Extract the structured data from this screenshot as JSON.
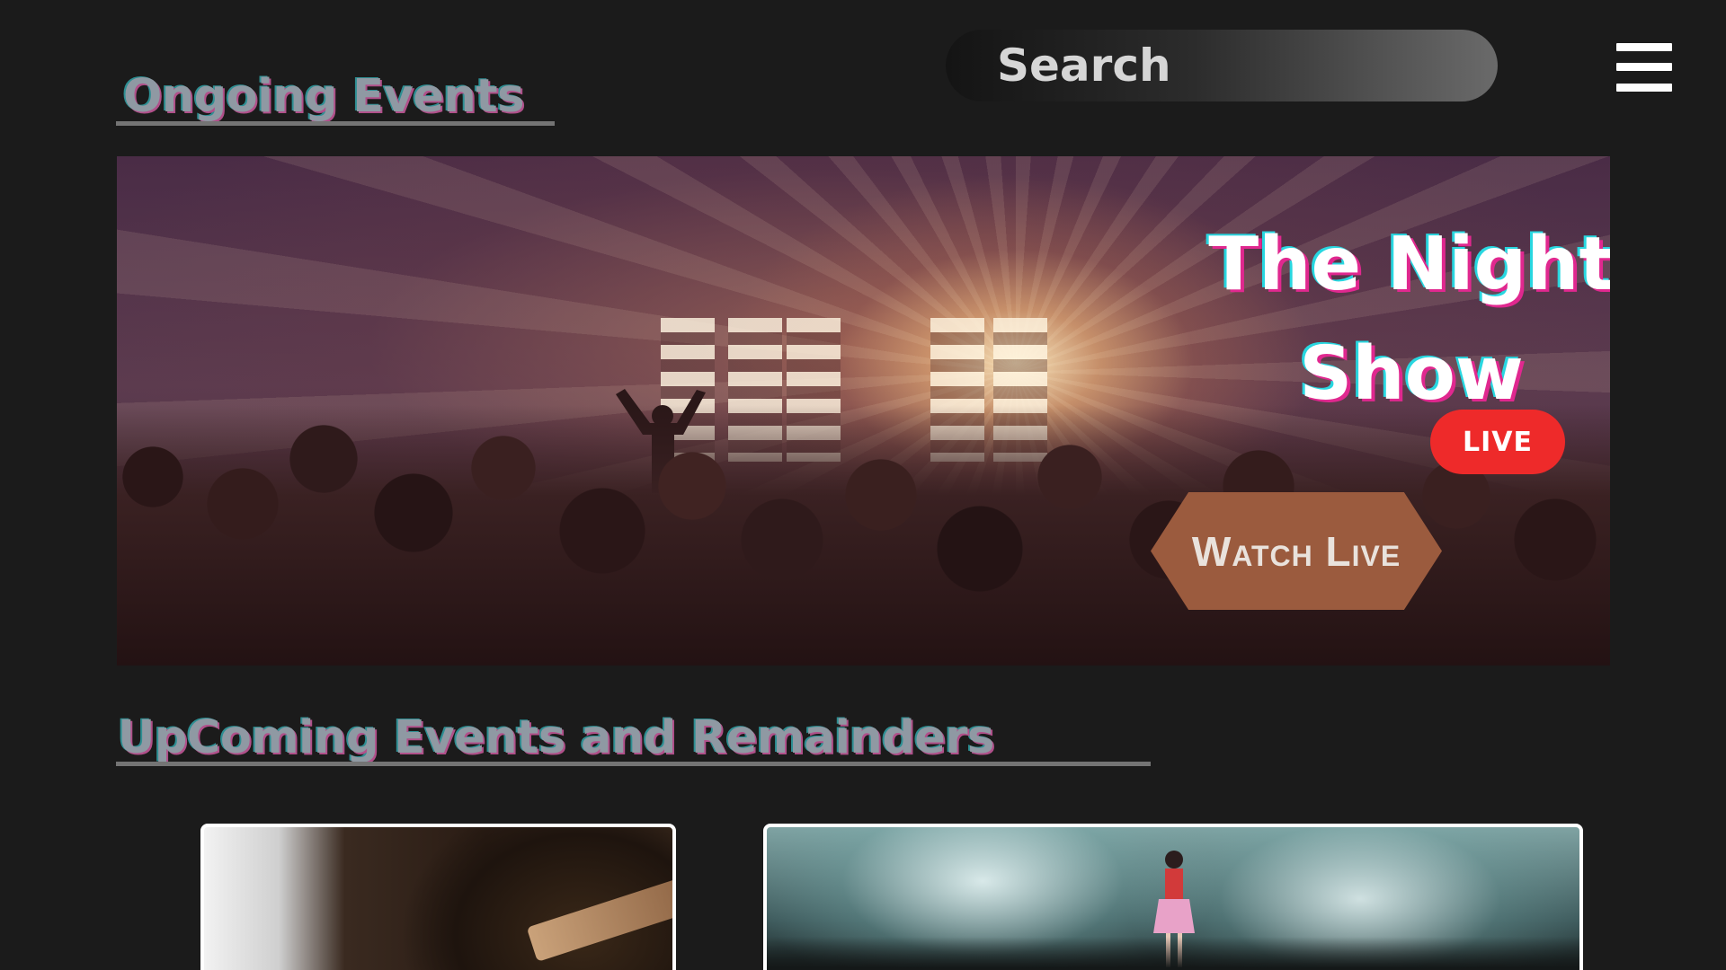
{
  "header": {
    "ongoing_title": "Ongoing Events",
    "search_placeholder": "Search",
    "menu_icon": "hamburger-menu-icon"
  },
  "hero": {
    "title_line1": "The Night",
    "title_line2": "Show",
    "live_label": "LIVE",
    "watch_label": "Watch Live",
    "image": "concert-crowd-image"
  },
  "upcoming": {
    "title": "UpComing Events and Remainders",
    "cards": [
      {
        "image": "guitar-closeup-image"
      },
      {
        "image": "concert-stage-singer-image"
      }
    ]
  },
  "colors": {
    "background": "#1b1b1b",
    "heading": "#8f99a3",
    "live_red": "#ee2a2a",
    "watch_button": "#9b5b3e"
  }
}
